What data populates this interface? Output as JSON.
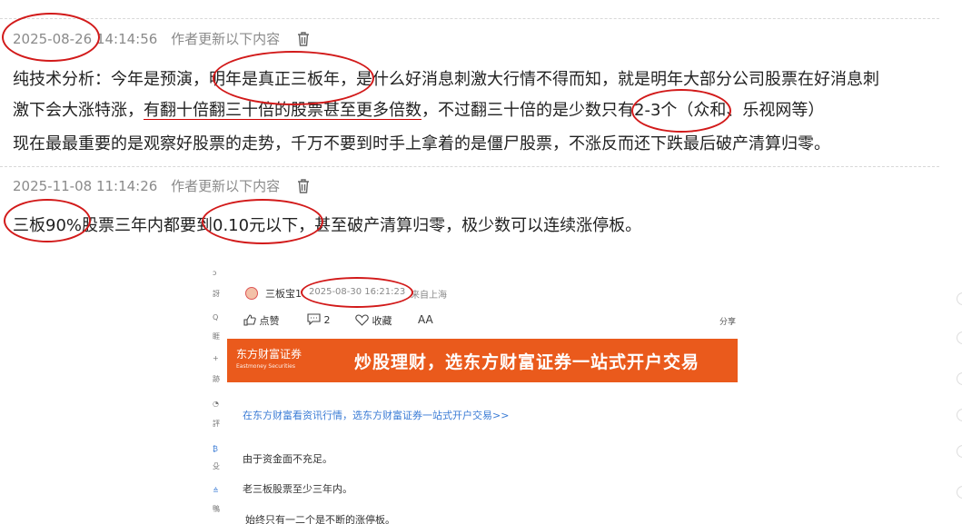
{
  "comment1": {
    "timestamp": "2025-08-26 14:14:56",
    "note": "作者更新以下内容",
    "lines": {
      "l1a": "纯技术分析：今年是预演，",
      "l1b": "明年是真正三板年",
      "l1c": "，是什么好消息刺激大行情不得而知，就是明年大部分公司股票在好消息刺",
      "l2a": "激下会大涨特涨，",
      "l2b": "有翻十倍翻三十倍的股票甚至更多倍数",
      "l2c": "，不过翻三十倍的是少数只有2-3个（众和、乐视网等）",
      "l3": "现在最最重要的是观察好股票的走势，千万不要到时手上拿着的是僵尸股票，不涨反而还下跌最后破产清算归零。"
    }
  },
  "comment2": {
    "timestamp": "2025-11-08 11:14:26",
    "note": "作者更新以下内容",
    "line": "三板90%股票三年内都要到0.10元以下，甚至破产清算归零，极少数可以连续涨停板。"
  },
  "screenshot": {
    "author": "三板宝1",
    "time": "2025-08-30 16:21:23",
    "location": "来自上海",
    "like": "点赞",
    "comment_count": "2",
    "collect": "收藏",
    "font_size": "AA",
    "share": "分享",
    "banner_logo": "东方财富证券",
    "banner_logo_en": "Eastmoney Securities",
    "banner_text": "炒股理财，选东方财富证券一站式开户交易",
    "link": "在东方财富看资讯行情，选东方财富证券一站式开户交易>>",
    "p1": "由于资金面不充足。",
    "p2": "老三板股票至少三年内。",
    "p3": "始终只有一二个是不断的涨停板。"
  },
  "colors": {
    "accent_red": "#d21a1a",
    "banner_orange": "#ea5a1c",
    "link_blue": "#3a7bd5"
  }
}
